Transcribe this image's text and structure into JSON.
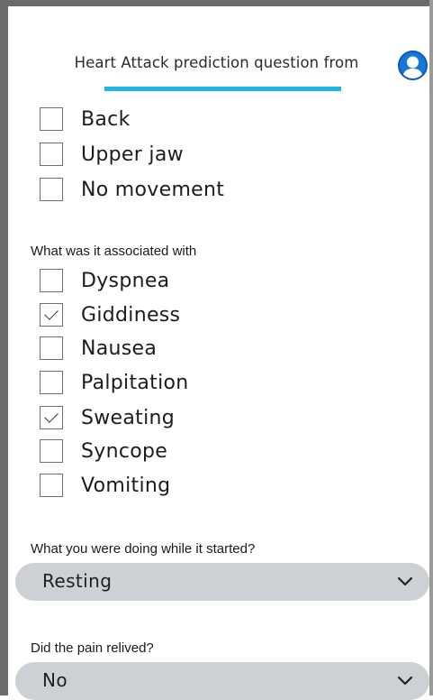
{
  "header": {
    "title": "Heart Attack prediction question from"
  },
  "radiation_options": [
    {
      "label": "Back",
      "checked": false
    },
    {
      "label": "Upper jaw",
      "checked": false
    },
    {
      "label": "No movement",
      "checked": false
    }
  ],
  "associated": {
    "label": "What was it associated with",
    "options": [
      {
        "label": "Dyspnea",
        "checked": false
      },
      {
        "label": "Giddiness",
        "checked": true
      },
      {
        "label": "Nausea",
        "checked": false
      },
      {
        "label": "Palpitation",
        "checked": false
      },
      {
        "label": "Sweating",
        "checked": true
      },
      {
        "label": "Syncope",
        "checked": false
      },
      {
        "label": "Vomiting",
        "checked": false
      }
    ]
  },
  "activity": {
    "label": "What you were doing while it started?",
    "selected": "Resting"
  },
  "pain_relieved": {
    "label": "Did the pain relived?",
    "selected": "No"
  },
  "colors": {
    "accent": "#1fb6e8",
    "avatar": "#1877d6",
    "select_bg": "#cfd0d3"
  },
  "icons": [
    "user-avatar-icon",
    "checkmark-icon",
    "chevron-down-icon"
  ]
}
